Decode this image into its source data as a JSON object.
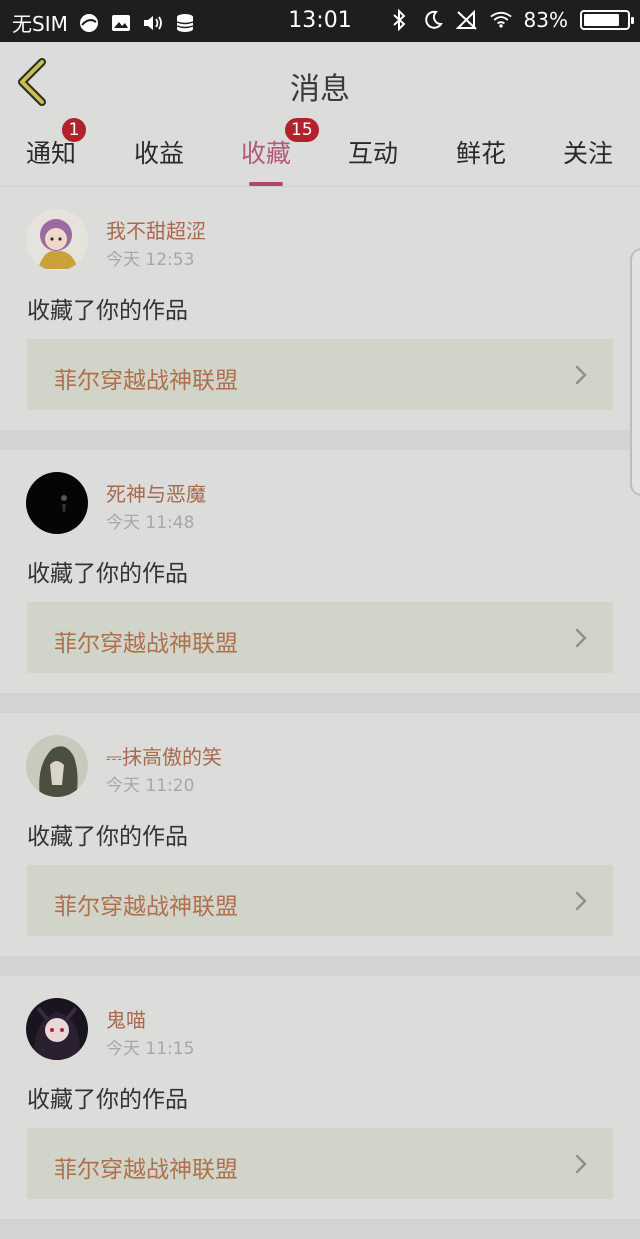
{
  "status_bar": {
    "carrier": "无SIM",
    "time": "13:01",
    "battery_pct": "83%",
    "battery_level": 0.83
  },
  "header": {
    "title": "消息"
  },
  "tabs": [
    {
      "label": "通知",
      "badge": "1",
      "active": false
    },
    {
      "label": "收益",
      "badge": "",
      "active": false
    },
    {
      "label": "收藏",
      "badge": "15",
      "active": true
    },
    {
      "label": "互动",
      "badge": "",
      "active": false
    },
    {
      "label": "鲜花",
      "badge": "",
      "active": false
    },
    {
      "label": "关注",
      "badge": "",
      "active": false
    }
  ],
  "items": [
    {
      "user": "我不甜超涩",
      "time": "今天 12:53",
      "action": "收藏了你的作品",
      "work": "菲尔穿越战神联盟"
    },
    {
      "user": "死神与恶魔",
      "time": "今天 11:48",
      "action": "收藏了你的作品",
      "work": "菲尔穿越战神联盟"
    },
    {
      "user": "⎓抹高傲的笑",
      "time": "今天 11:20",
      "action": "收藏了你的作品",
      "work": "菲尔穿越战神联盟"
    },
    {
      "user": "鬼喵",
      "time": "今天 11:15",
      "action": "收藏了你的作品",
      "work": "菲尔穿越战神联盟"
    }
  ],
  "colors": {
    "accent": "#b0456b",
    "badge": "#b2222c",
    "username": "#a86a4f",
    "work_title": "#b0704e"
  }
}
